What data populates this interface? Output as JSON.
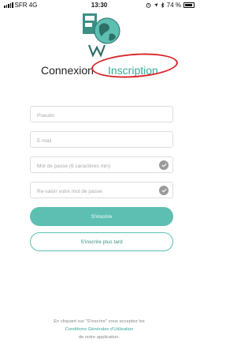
{
  "status_bar": {
    "carrier": "SFR  4G",
    "time": "13:30",
    "battery": "74 %"
  },
  "tabs": {
    "login": "Connexion",
    "signup": "Inscription"
  },
  "form": {
    "pseudo_placeholder": "Pseudo",
    "email_placeholder": "E-mail",
    "password_placeholder": "Mot de passe (6 caractères min)",
    "confirm_placeholder": "Re-saisir votre mot de passe"
  },
  "buttons": {
    "signup": "S'inscrire",
    "later": "S'inscrire plus tard"
  },
  "terms": {
    "line1": "En cliquant sur \"S'inscrire\" vous acceptez les",
    "link": "Conditions Générales d'Utilisation",
    "line2": "de notre application."
  },
  "colors": {
    "accent": "#5cbfb2",
    "accent_text": "#3aa89b",
    "highlight": "#d9262c"
  }
}
